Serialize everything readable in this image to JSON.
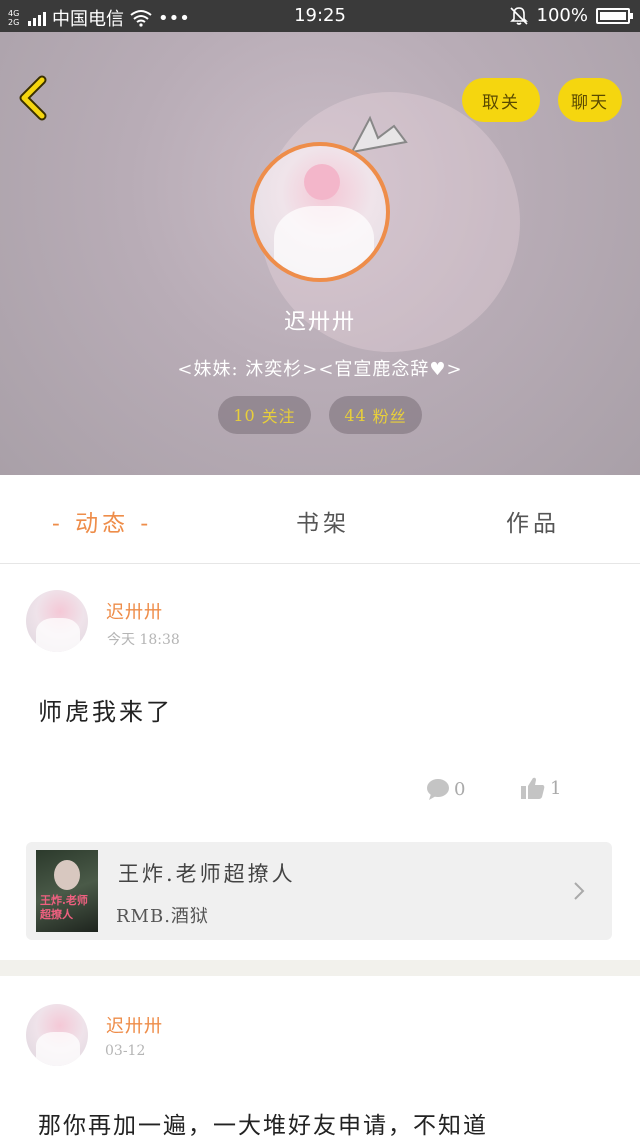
{
  "status_bar": {
    "network": "4G\n2G",
    "carrier": "中国电信",
    "dots": "•••",
    "time": "19:25",
    "battery": "100%",
    "battery_level": 1.0
  },
  "header": {
    "unfollow_label": "取关",
    "chat_label": "聊天",
    "username": "迟卅卅",
    "bio": "<妹妹: 沐奕杉><官宣鹿念辞♥>",
    "following_count": "10",
    "following_label": "关注",
    "fans_count": "44",
    "fans_label": "粉丝"
  },
  "tabs": [
    {
      "label": "- 动态 -",
      "active": true
    },
    {
      "label": "书架",
      "active": false
    },
    {
      "label": "作品",
      "active": false
    }
  ],
  "posts": [
    {
      "author": "迟卅卅",
      "time": "今天 18:38",
      "text": "师虎我来了",
      "comments": "0",
      "likes": "1",
      "book": {
        "title": "王炸.老师超撩人",
        "author": "RMB.酒狱"
      }
    },
    {
      "author": "迟卅卅",
      "time": "03-12",
      "text": "那你再加一遍，一大堆好友申请，不知道"
    }
  ],
  "colors": {
    "accent": "#ee8d4a",
    "button_yellow": "#f5d60f",
    "stat_text": "#e8cf3a"
  }
}
